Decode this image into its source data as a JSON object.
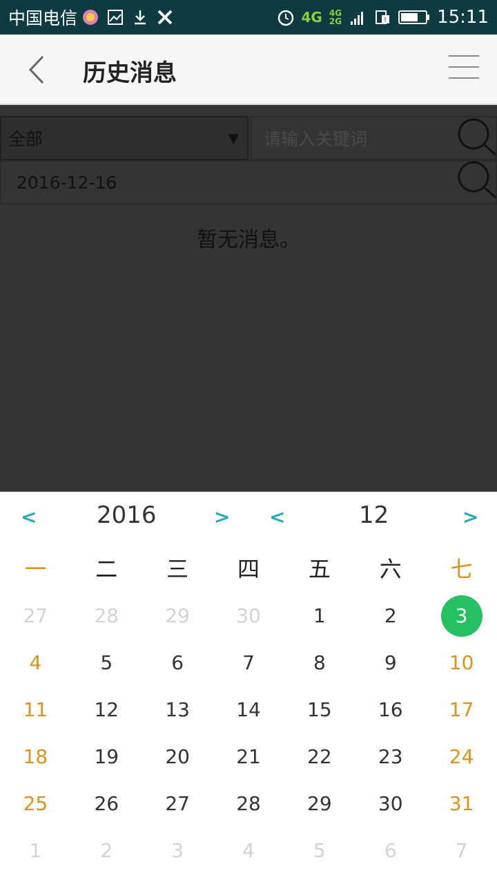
{
  "status_bar": {
    "carrier": "中国电信",
    "network": "4G",
    "network_small_top": "4G",
    "network_small_bottom": "2G",
    "time": "15:11"
  },
  "header": {
    "title": "历史消息"
  },
  "filters": {
    "category_selected": "全部",
    "keyword_placeholder": "请输入关键词",
    "date_value": "2016-12-16"
  },
  "empty_message": "暂无消息。",
  "calendar": {
    "year": "2016",
    "month": "12",
    "prev_symbol": "<",
    "next_symbol": ">",
    "weekdays": [
      "一",
      "二",
      "三",
      "四",
      "五",
      "六",
      "七"
    ],
    "weeks": [
      [
        "27",
        "28",
        "29",
        "30",
        "1",
        "2",
        "3"
      ],
      [
        "4",
        "5",
        "6",
        "7",
        "8",
        "9",
        "10"
      ],
      [
        "11",
        "12",
        "13",
        "14",
        "15",
        "16",
        "17"
      ],
      [
        "18",
        "19",
        "20",
        "21",
        "22",
        "23",
        "24"
      ],
      [
        "25",
        "26",
        "27",
        "28",
        "29",
        "30",
        "31"
      ],
      [
        "1",
        "2",
        "3",
        "4",
        "5",
        "6",
        "7"
      ]
    ],
    "selected_day": "3",
    "colors": {
      "weekend": "#e0911a",
      "selected": "#25c060",
      "nav_arrow": "#2aa9b8",
      "other_month": "#d3d3d3"
    }
  }
}
